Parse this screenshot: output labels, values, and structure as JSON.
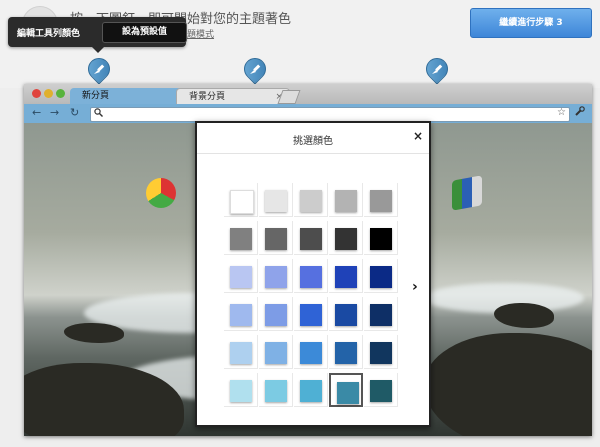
{
  "instruction": {
    "text": "按一下圖釘，即可開始對您的主題著色",
    "sub_text": "主題模式",
    "next_button": "繼續進行步驟 3"
  },
  "tooltip": {
    "label": "編輯工具列顏色",
    "button": "設為預設值"
  },
  "browser": {
    "tabs": [
      {
        "label": "新分頁",
        "active": true
      },
      {
        "label": "背景分頁",
        "active": false
      }
    ],
    "tab_close": "×",
    "icons": {
      "back": "←",
      "forward": "→",
      "reload": "↻",
      "search": "🔍",
      "star": "☆",
      "wrench": "🔧"
    }
  },
  "dialog": {
    "title": "挑選顏色",
    "close": "×",
    "next_arrow": "›",
    "swatches": [
      [
        "#ffffff",
        "#e6e6e6",
        "#cccccc",
        "#b3b3b3",
        "#999999"
      ],
      [
        "#808080",
        "#666666",
        "#4d4d4d",
        "#333333",
        "#000000"
      ],
      [
        "#b9c6f2",
        "#8fa3ea",
        "#5670e0",
        "#1f42b8",
        "#0b2a86"
      ],
      [
        "#9fb9ee",
        "#7d9ce6",
        "#2f63d6",
        "#1a4aa3",
        "#0e2f66"
      ],
      [
        "#aed0ef",
        "#7fb1e5",
        "#3c8ad8",
        "#2363a8",
        "#11365e"
      ],
      [
        "#b0e0ee",
        "#7ccbe3",
        "#4fb0d4",
        "#3a8aa6",
        "#1f5a66"
      ]
    ],
    "selected_index": [
      5,
      3
    ]
  },
  "colors": {
    "accent": "#3e86d8",
    "pin": "#4a8fc4",
    "toolbar": "#76aed6"
  }
}
